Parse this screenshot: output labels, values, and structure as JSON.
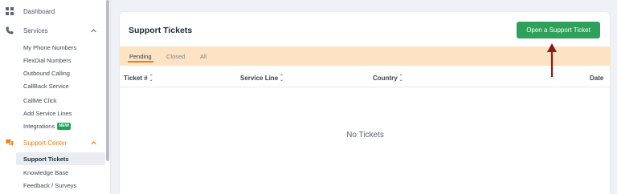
{
  "sidebar": {
    "dashboard": "Dashboard",
    "services": "Services",
    "services_items": [
      "My Phone Numbers",
      "FlexDial Numbers",
      "Outbound Calling",
      "CallBack Service",
      "CallMe Click",
      "Add Service Lines",
      "Integrations"
    ],
    "new_badge": "NEW",
    "support_center": "Support Center",
    "support_items": [
      "Support Tickets",
      "Knowledge Base",
      "Feedback / Surveys"
    ]
  },
  "main": {
    "title": "Support Tickets",
    "open_button": "Open a Support Ticket",
    "tabs": [
      "Pending",
      "Closed",
      "All"
    ],
    "columns": [
      "Ticket #",
      "Service Line",
      "Country",
      "Date"
    ],
    "empty_text": "No Tickets"
  },
  "colors": {
    "accent_orange": "#e8801e",
    "button_green": "#2ea05b",
    "tabs_bg": "#fde3c4",
    "annotation_arrow": "#8b1a1a"
  }
}
